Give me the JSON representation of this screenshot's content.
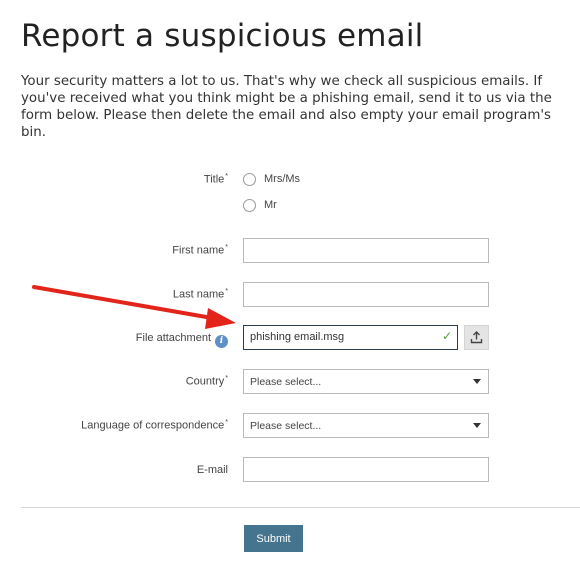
{
  "page": {
    "title": "Report a suspicious email",
    "intro": "Your security matters a lot to us. That's why we check all suspicious emails. If you've received what you think might be a phishing email, send it to us via the form below. Please then delete the email and also empty your email program's bin."
  },
  "form": {
    "title": {
      "label": "Title",
      "required_mark": "*",
      "options": [
        "Mrs/Ms",
        "Mr"
      ]
    },
    "first_name": {
      "label": "First name",
      "required_mark": "*",
      "value": ""
    },
    "last_name": {
      "label": "Last name",
      "required_mark": "*",
      "value": ""
    },
    "file_attachment": {
      "label": "File attachment",
      "value": "phishing email.msg",
      "info_icon": "info-icon",
      "valid_icon": "checkmark-icon",
      "upload_icon": "upload-icon"
    },
    "country": {
      "label": "Country",
      "required_mark": "*",
      "selected": "Please select..."
    },
    "language": {
      "label": "Language of correspondence",
      "required_mark": "*",
      "selected": "Please select..."
    },
    "email": {
      "label": "E-mail",
      "value": ""
    },
    "submit_label": "Submit"
  },
  "colors": {
    "submit_button": "#45758e",
    "annotation_arrow": "#e3241b",
    "info_icon": "#5e8fc7",
    "valid_check": "#5a9a2a"
  }
}
